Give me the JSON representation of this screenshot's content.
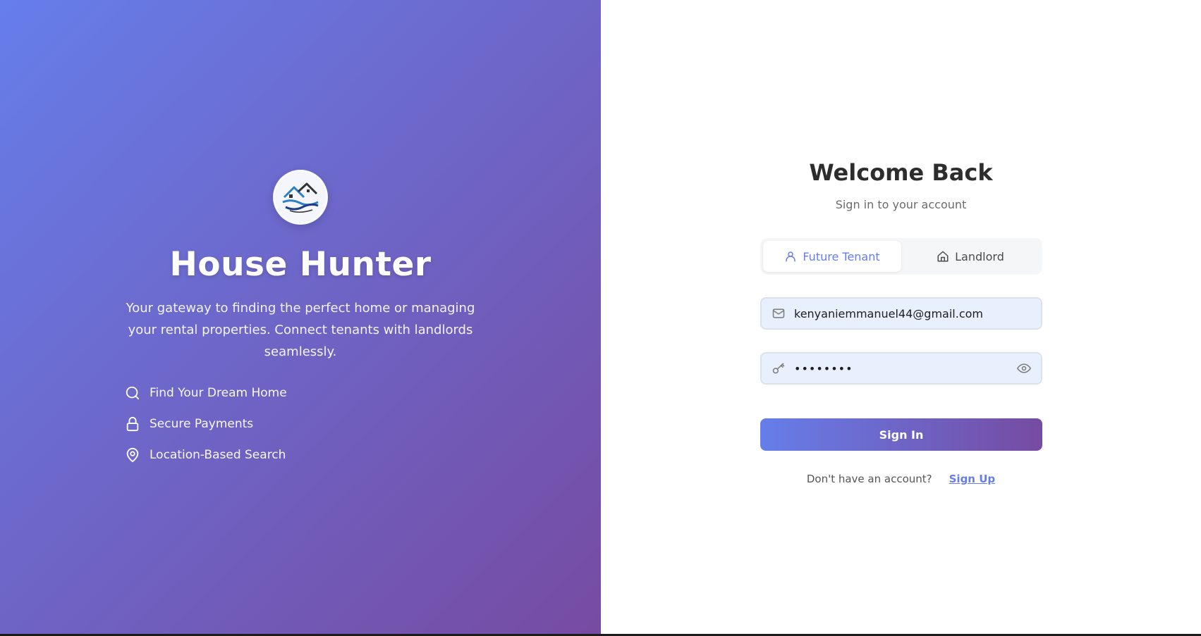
{
  "brand": {
    "title": "House Hunter",
    "description": "Your gateway to finding the perfect home or managing your rental properties. Connect tenants with landlords seamlessly.",
    "logo_icon": "house-logo-icon"
  },
  "features": [
    {
      "icon": "search-icon",
      "label": "Find Your Dream Home"
    },
    {
      "icon": "lock-icon",
      "label": "Secure Payments"
    },
    {
      "icon": "map-pin-icon",
      "label": "Location-Based Search"
    }
  ],
  "login": {
    "title": "Welcome Back",
    "subtitle": "Sign in to your account",
    "tabs": [
      {
        "label": "Future Tenant",
        "icon": "user-icon",
        "active": true
      },
      {
        "label": "Landlord",
        "icon": "home-icon",
        "active": false
      }
    ],
    "email_value": "kenyaniemmanuel44@gmail.com",
    "password_masked": "••••••••",
    "sign_in_label": "Sign In",
    "no_account_text": "Don't have an account?",
    "sign_up_label": "Sign Up"
  },
  "colors": {
    "gradient_start": "#667eea",
    "gradient_end": "#764ba2",
    "accent": "#667eea",
    "input_bg": "#e8f0fe"
  }
}
